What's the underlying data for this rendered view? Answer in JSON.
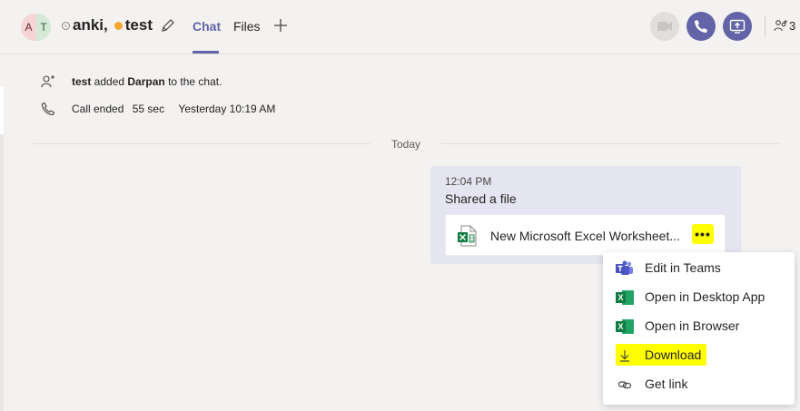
{
  "header": {
    "avatar_initials": [
      "A",
      "T"
    ],
    "title_part1": "anki,",
    "title_part2": "test",
    "tabs": [
      {
        "label": "Chat",
        "active": true
      },
      {
        "label": "Files",
        "active": false
      }
    ],
    "participant_count": "3"
  },
  "events": [
    {
      "icon": "person-add-icon",
      "actor": "test",
      "text_mid": " added ",
      "target": "Darpan",
      "text_end": " to the chat."
    },
    {
      "icon": "phone-icon",
      "text": "Call ended",
      "duration": "55 sec",
      "when": "Yesterday 10:19 AM"
    }
  ],
  "day_separator": "Today",
  "message": {
    "time": "12:04 PM",
    "text": "Shared a file",
    "file_name": "New Microsoft Excel Worksheet...",
    "more_label": "•••"
  },
  "context_menu": {
    "items": [
      {
        "label": "Edit in Teams",
        "icon": "teams-icon"
      },
      {
        "label": "Open in Desktop App",
        "icon": "excel-icon"
      },
      {
        "label": "Open in Browser",
        "icon": "excel-icon"
      },
      {
        "label": "Download",
        "icon": "download-icon",
        "highlighted": true
      },
      {
        "label": "Get link",
        "icon": "link-icon"
      }
    ]
  },
  "colors": {
    "accent": "#6264a7",
    "highlight": "#ffff00",
    "bubble": "#e5e5f1",
    "background": "#f3f2f1"
  }
}
